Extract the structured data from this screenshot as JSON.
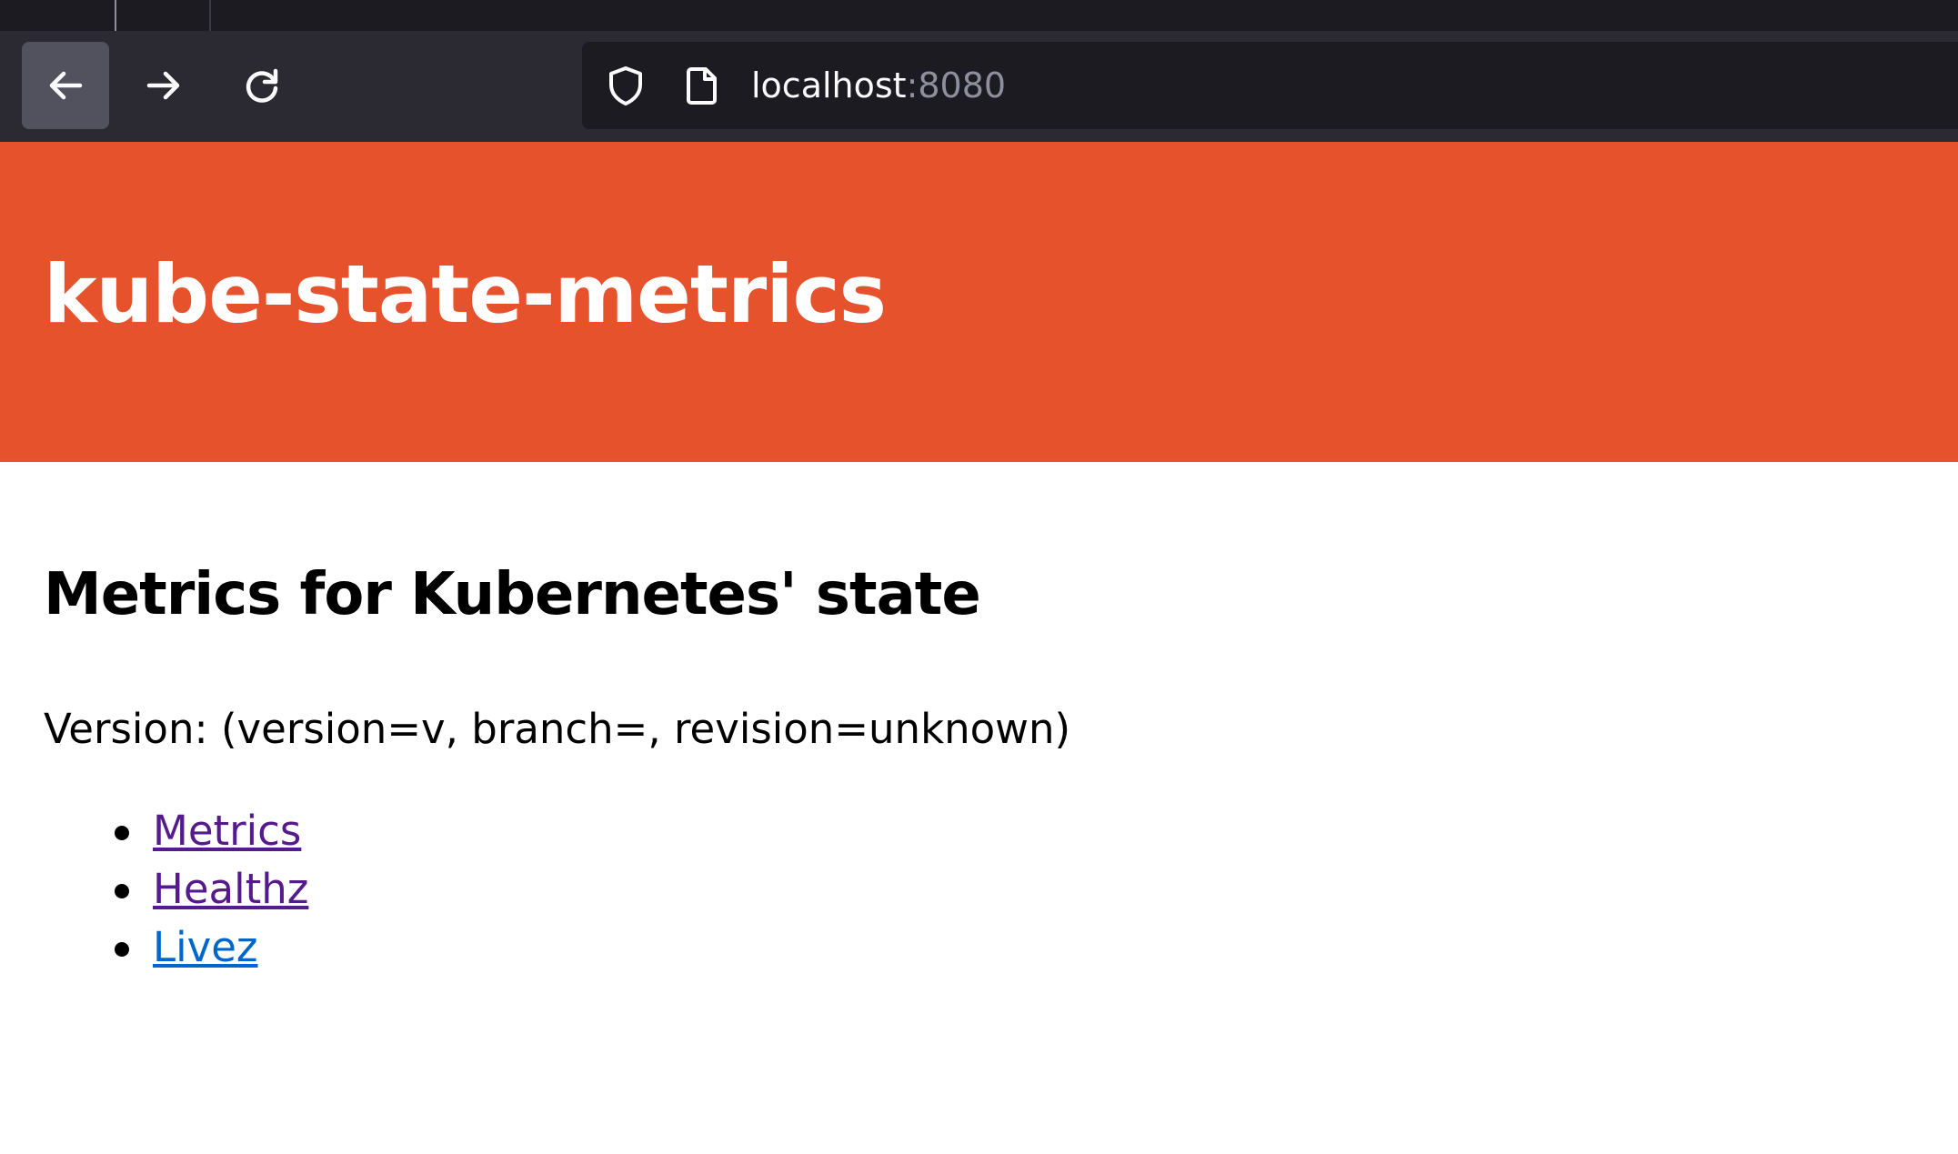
{
  "browser": {
    "url_host": "localhost",
    "url_port": ":8080",
    "buttons": {
      "back": "back-arrow-icon",
      "forward": "forward-arrow-icon",
      "reload": "reload-icon"
    },
    "colors": {
      "tabstrip": "#1c1b22",
      "toolbar": "#2b2a33",
      "urlbar": "#1c1b22",
      "active_button": "#52525e"
    }
  },
  "page": {
    "banner_title": "kube-state-metrics",
    "heading": "Metrics for Kubernetes' state",
    "version_text": "Version: (version=v, branch=, revision=unknown)",
    "links": [
      {
        "label": "Metrics",
        "state": "visited"
      },
      {
        "label": "Healthz",
        "state": "visited"
      },
      {
        "label": "Livez",
        "state": "unvisited"
      }
    ],
    "colors": {
      "banner": "#e6522c",
      "visited_link": "#551a8b",
      "unvisited_link": "#0066cc"
    }
  }
}
